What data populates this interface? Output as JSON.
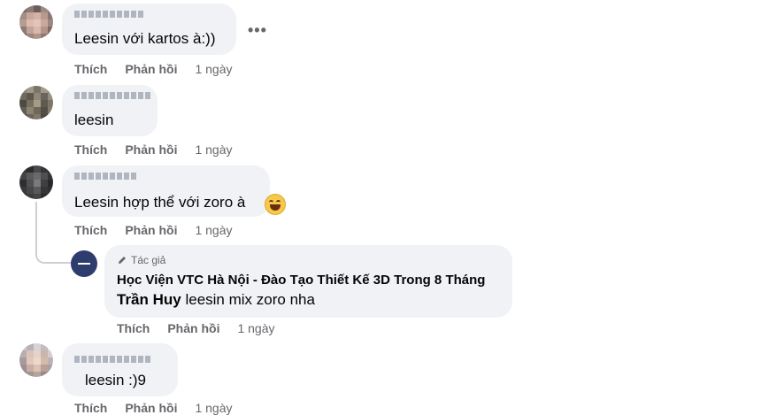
{
  "comments": [
    {
      "text": "Leesin với kartos à:))",
      "actions": {
        "like": "Thích",
        "reply": "Phản hồi",
        "time": "1 ngày"
      },
      "more": "•••"
    },
    {
      "text": "leesin",
      "actions": {
        "like": "Thích",
        "reply": "Phản hồi",
        "time": "1 ngày"
      }
    },
    {
      "text": "Leesin hợp thể với zoro à",
      "emoji": "grinning-squinting-face",
      "actions": {
        "like": "Thích",
        "reply": "Phản hồi",
        "time": "1 ngày"
      },
      "reply": {
        "author_tag": "Tác giả",
        "page_name": "Học Viện VTC Hà Nội - Đào Tạo Thiết Kế 3D Trong 8 Tháng",
        "mention": "Trần Huy",
        "text": " leesin mix zoro nha",
        "actions": {
          "like": "Thích",
          "reply": "Phản hồi",
          "time": "1 ngày"
        }
      }
    },
    {
      "text": "leesin :)9",
      "actions": {
        "like": "Thích",
        "reply": "Phản hồi",
        "time": "1 ngày"
      }
    }
  ],
  "colors": {
    "bubble": "#f0f2f5",
    "secondary_text": "#65676b",
    "page_avatar": "#2f3c6e"
  }
}
